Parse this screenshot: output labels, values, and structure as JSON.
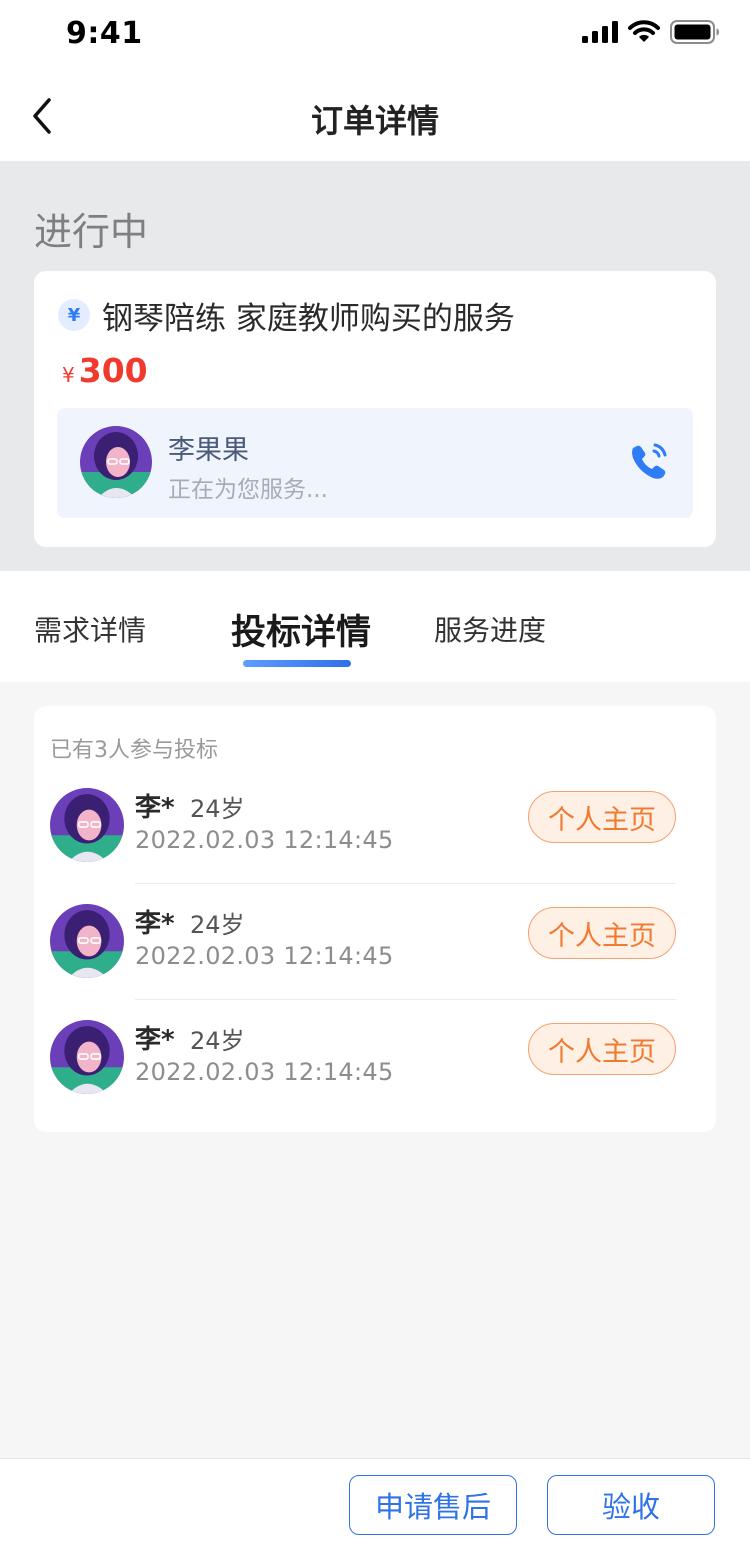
{
  "status_bar": {
    "time": "9:41"
  },
  "nav": {
    "title": "订单详情"
  },
  "order": {
    "status": "进行中",
    "currency_badge": "¥",
    "service_title": "钢琴陪练 家庭教师购买的服务",
    "price_symbol": "¥",
    "price": "300",
    "provider": {
      "name": "李果果",
      "status": "正在为您服务..."
    }
  },
  "tabs": [
    {
      "label": "需求详情",
      "active": false
    },
    {
      "label": "投标详情",
      "active": true
    },
    {
      "label": "服务进度",
      "active": false
    }
  ],
  "bids": {
    "count_text": "已有3人参与投标",
    "items": [
      {
        "name": "李*",
        "age": "24岁",
        "time": "2022.02.03 12:14:45",
        "button": "个人主页"
      },
      {
        "name": "李*",
        "age": "24岁",
        "time": "2022.02.03 12:14:45",
        "button": "个人主页"
      },
      {
        "name": "李*",
        "age": "24岁",
        "time": "2022.02.03 12:14:45",
        "button": "个人主页"
      }
    ]
  },
  "actions": {
    "after_sale": "申请售后",
    "accept": "验收"
  },
  "colors": {
    "accent": "#2f73e6",
    "price": "#f03a2e",
    "profile_button": "#f07a30"
  },
  "icons": [
    "signal-icon",
    "wifi-icon",
    "battery-icon",
    "back-arrow-icon",
    "yen-icon",
    "phone-icon",
    "avatar"
  ]
}
